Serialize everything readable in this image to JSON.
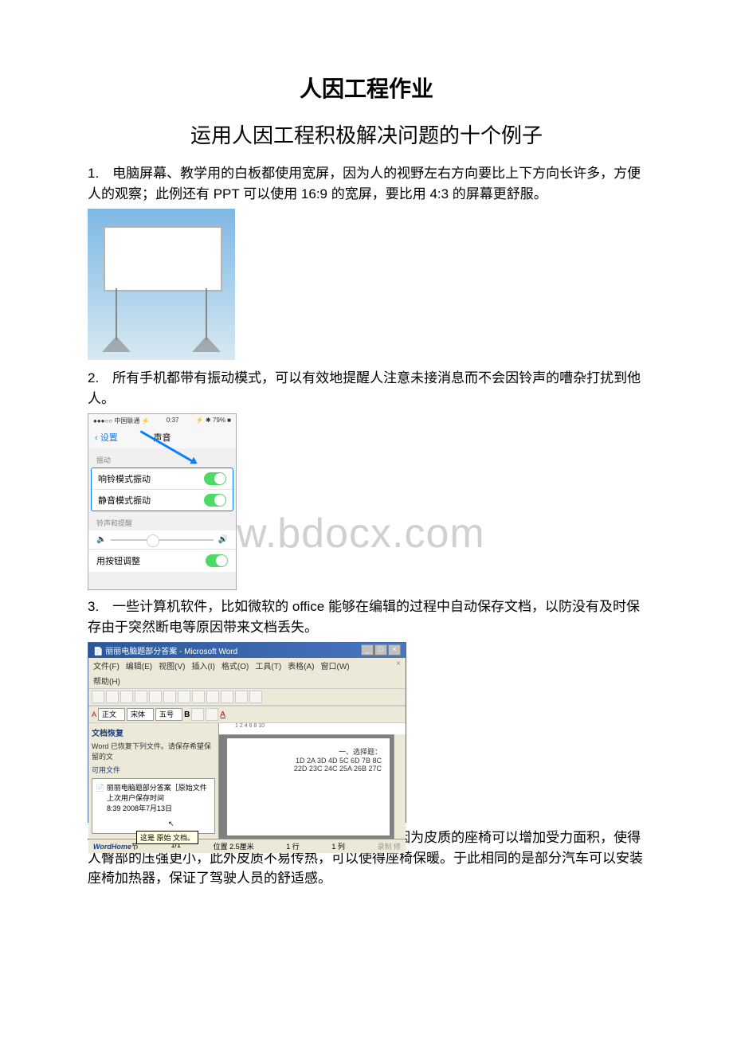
{
  "doc": {
    "title_main": "人因工程作业",
    "title_sub": "运用人因工程积极解决问题的十个例子",
    "watermark": "www.bdocx.com",
    "p1": "1.　电脑屏幕、教学用的白板都使用宽屏，因为人的视野左右方向要比上下方向长许多，方便人的观察；此例还有 PPT 可以使用 16:9 的宽屏，要比用 4:3 的屏幕更舒服。",
    "p2": "2.　所有手机都带有振动模式，可以有效地提醒人注意未接消息而不会因铃声的嘈杂打扰到他人。",
    "p3": "3.　一些计算机软件，比如微软的 office 能够在编辑的过程中自动保存文档，以防没有及时保存由于突然断电等原因带来文档丢失。",
    "p4": "4.　汽车皮质的座椅可以有效地提高座椅的舒适感，因为皮质的座椅可以增加受力面积，使得人臀部的压强更小，此外皮质不易传热，可以使得座椅保暖。于此相同的是部分汽车可以安装座椅加热器，保证了驾驶人员的舒适感。"
  },
  "ios": {
    "status_left": "●●●○○ 中国联通 ⚡",
    "status_mid": "0:37",
    "status_right": "⚡ ✱ 79% ■",
    "back": "设置",
    "title": "声音",
    "section_vib": "振动",
    "row_ring_vib": "响铃模式振动",
    "row_silent_vib": "静音模式振动",
    "section_alert": "铃声和提醒",
    "spk_low": "🔈",
    "spk_high": "🔊",
    "row_button_adj": "用按钮调整"
  },
  "word": {
    "title": "丽丽电脑题部分答案 - Microsoft Word",
    "menu": {
      "file": "文件(F)",
      "edit": "编辑(E)",
      "view": "视图(V)",
      "insert": "插入(I)",
      "format": "格式(O)",
      "tools": "工具(T)",
      "table": "表格(A)",
      "window": "窗口(W)",
      "help": "帮助(H)"
    },
    "style_label": "正文",
    "font_label": "宋体",
    "size_label": "五号",
    "ruler": "1    2    4    6    8    10",
    "recovery_title": "文档恢复",
    "recovery_text": "Word 已恢复下列文件。请保存希望保留的文",
    "avail_label": "可用文件",
    "file_name": "丽丽电脑题部分答案［原始文件",
    "file_line2": "上次用户保存时间",
    "file_line3": "8:39 2008年7月13日",
    "tooltip": "这是 原始 文档。",
    "doc_line1": "一、选择题：",
    "doc_line2": "1D 2A 3D 4D 5C 6D 7B 8C",
    "doc_line3": "22D 23C 24C 25A 26B 27C",
    "status_brand": "WordHome",
    "status_sec": "节",
    "status_page": "1/1",
    "status_pos": "位置 2.5厘米",
    "status_line": "1 行",
    "status_col": "1 列",
    "status_rec": "录制 修"
  }
}
